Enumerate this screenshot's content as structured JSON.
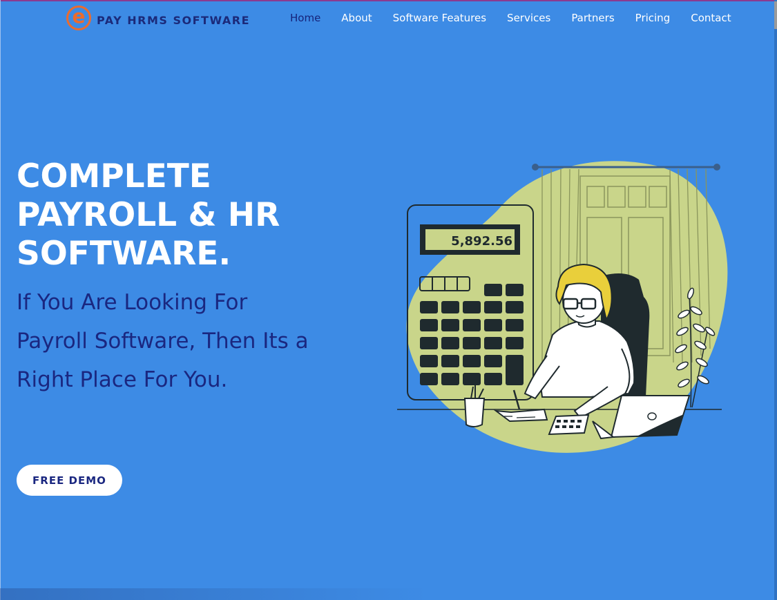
{
  "header": {
    "logo_letter": "e",
    "logo_text": "PAY HRMS SOFTWARE",
    "nav": [
      {
        "label": "Home",
        "active": true
      },
      {
        "label": "About",
        "active": false
      },
      {
        "label": "Software Features",
        "active": false
      },
      {
        "label": "Services",
        "active": false
      },
      {
        "label": "Partners",
        "active": false
      },
      {
        "label": "Pricing",
        "active": false
      },
      {
        "label": "Contact",
        "active": false
      }
    ]
  },
  "hero": {
    "title_lines": [
      "COMPLETE",
      "PAYROLL & HR",
      "SOFTWARE."
    ],
    "subtitle_lines": [
      "If You Are Looking For",
      "Payroll Software, Then Its a",
      "Right Place For You."
    ],
    "cta_label": "FREE DEMO"
  },
  "illustration": {
    "calculator_display": "5,892.56"
  },
  "colors": {
    "background": "#3d8be5",
    "title": "#ffffff",
    "subtitle": "#1a2780",
    "nav_active": "#16237a",
    "logo_orange": "#ec6b2d",
    "blob": "#c9d58a",
    "dark": "#1f2a2e"
  }
}
